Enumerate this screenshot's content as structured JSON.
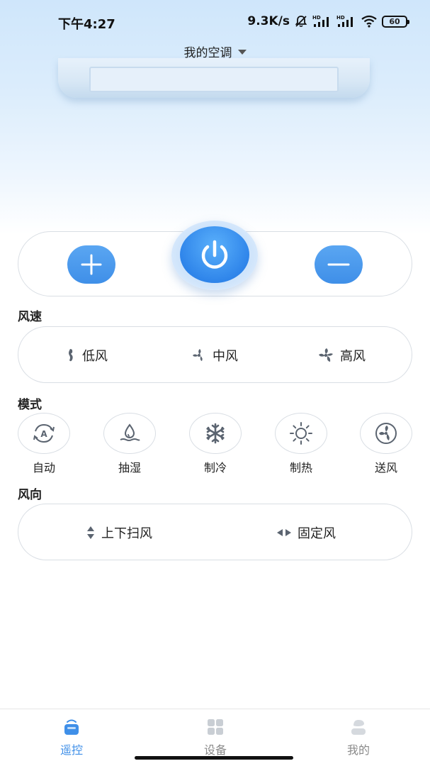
{
  "status_bar": {
    "time": "下午4:27",
    "net_speed": "9.3K/s",
    "battery": "60"
  },
  "header": {
    "device_title": "我的空调"
  },
  "controls": {
    "plus_icon": "plus-icon",
    "power_icon": "power-icon",
    "minus_icon": "minus-icon"
  },
  "fan_speed": {
    "label": "风速",
    "options": [
      {
        "label": "低风",
        "icon": "fan-low-icon"
      },
      {
        "label": "中风",
        "icon": "fan-medium-icon"
      },
      {
        "label": "高风",
        "icon": "fan-high-icon"
      }
    ]
  },
  "mode": {
    "label": "模式",
    "options": [
      {
        "label": "自动",
        "icon": "auto-mode-icon"
      },
      {
        "label": "抽湿",
        "icon": "dehumidify-icon"
      },
      {
        "label": "制冷",
        "icon": "snowflake-icon"
      },
      {
        "label": "制热",
        "icon": "sun-icon"
      },
      {
        "label": "送风",
        "icon": "fan-icon"
      }
    ]
  },
  "wind_direction": {
    "label": "风向",
    "options": [
      {
        "label": "上下扫风",
        "icon": "swing-vertical-icon"
      },
      {
        "label": "固定风",
        "icon": "fixed-direction-icon"
      }
    ]
  },
  "tabbar": {
    "tabs": [
      {
        "label": "遥控",
        "active": true
      },
      {
        "label": "设备",
        "active": false
      },
      {
        "label": "我的",
        "active": false
      }
    ]
  },
  "colors": {
    "accent": "#3f8fe8",
    "tab_active": "#3f8fe8",
    "tab_inactive": "#8a8a8a",
    "icon_gray": "#5b6470"
  }
}
